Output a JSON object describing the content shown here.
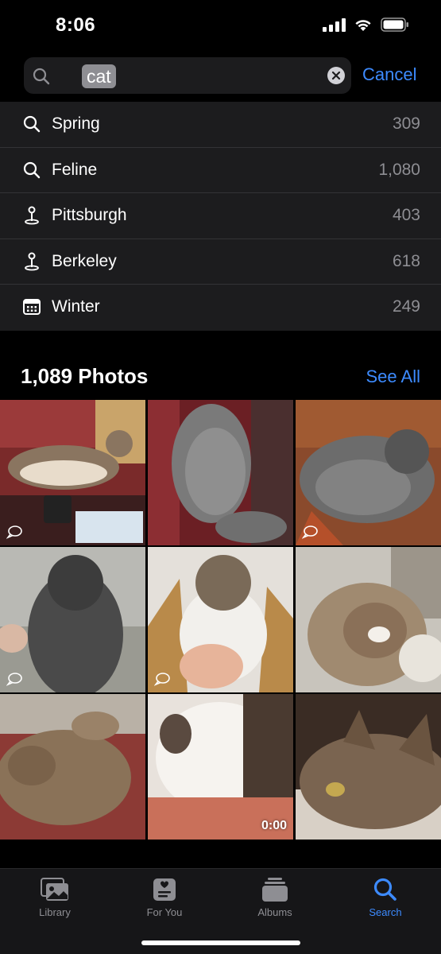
{
  "status": {
    "time": "8:06"
  },
  "search": {
    "query": "cat",
    "cancel_label": "Cancel"
  },
  "suggestions": [
    {
      "label": "Spring",
      "count": "309",
      "icon": "search-icon"
    },
    {
      "label": "Feline",
      "count": "1,080",
      "icon": "search-icon"
    },
    {
      "label": "Pittsburgh",
      "count": "403",
      "icon": "location-pin-icon"
    },
    {
      "label": "Berkeley",
      "count": "618",
      "icon": "location-pin-icon"
    },
    {
      "label": "Winter",
      "count": "249",
      "icon": "calendar-icon"
    }
  ],
  "photos": {
    "title": "1,089 Photos",
    "see_all_label": "See All",
    "video_duration": "0:00"
  },
  "tabs": [
    {
      "label": "Library",
      "icon": "photo-library-icon"
    },
    {
      "label": "For You",
      "icon": "for-you-icon"
    },
    {
      "label": "Albums",
      "icon": "albums-icon"
    },
    {
      "label": "Search",
      "icon": "search-icon"
    }
  ],
  "colors": {
    "accent": "#3d8bff",
    "background": "#000000",
    "list_bg": "#1c1c1e",
    "secondary_text": "#8e8e93"
  }
}
